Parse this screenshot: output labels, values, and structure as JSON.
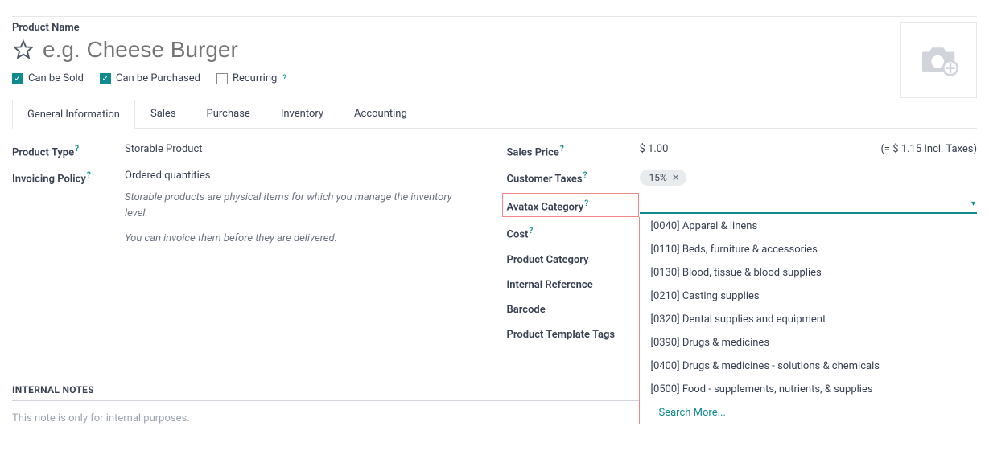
{
  "header": {
    "product_name_label": "Product Name",
    "product_name_placeholder": "e.g. Cheese Burger"
  },
  "checks": {
    "can_be_sold": "Can be Sold",
    "can_be_purchased": "Can be Purchased",
    "recurring": "Recurring"
  },
  "tabs": {
    "general": "General Information",
    "sales": "Sales",
    "purchase": "Purchase",
    "inventory": "Inventory",
    "accounting": "Accounting"
  },
  "left": {
    "product_type_label": "Product Type",
    "product_type_value": "Storable Product",
    "invoicing_policy_label": "Invoicing Policy",
    "invoicing_policy_value": "Ordered quantities",
    "desc1": "Storable products are physical items for which you manage the inventory level.",
    "desc2": "You can invoice them before they are delivered."
  },
  "right": {
    "sales_price_label": "Sales Price",
    "sales_price_value": "$ 1.00",
    "sales_price_incl": "(= $ 1.15 Incl. Taxes)",
    "customer_taxes_label": "Customer Taxes",
    "tax_tag": "15%",
    "avatax_label": "Avatax Category",
    "cost_label": "Cost",
    "product_category_label": "Product Category",
    "internal_reference_label": "Internal Reference",
    "barcode_label": "Barcode",
    "product_template_tags_label": "Product Template Tags"
  },
  "avatax_options": [
    "[0040] Apparel & linens",
    "[0110] Beds, furniture & accessories",
    "[0130] Blood, tissue & blood supplies",
    "[0210] Casting supplies",
    "[0320] Dental supplies and equipment",
    "[0390] Drugs & medicines",
    "[0400] Drugs & medicines - solutions & chemicals",
    "[0500] Food - supplements, nutrients, & supplies"
  ],
  "avatax_search_more": "Search More...",
  "notes": {
    "header": "INTERNAL NOTES",
    "placeholder": "This note is only for internal purposes."
  },
  "help": "?"
}
